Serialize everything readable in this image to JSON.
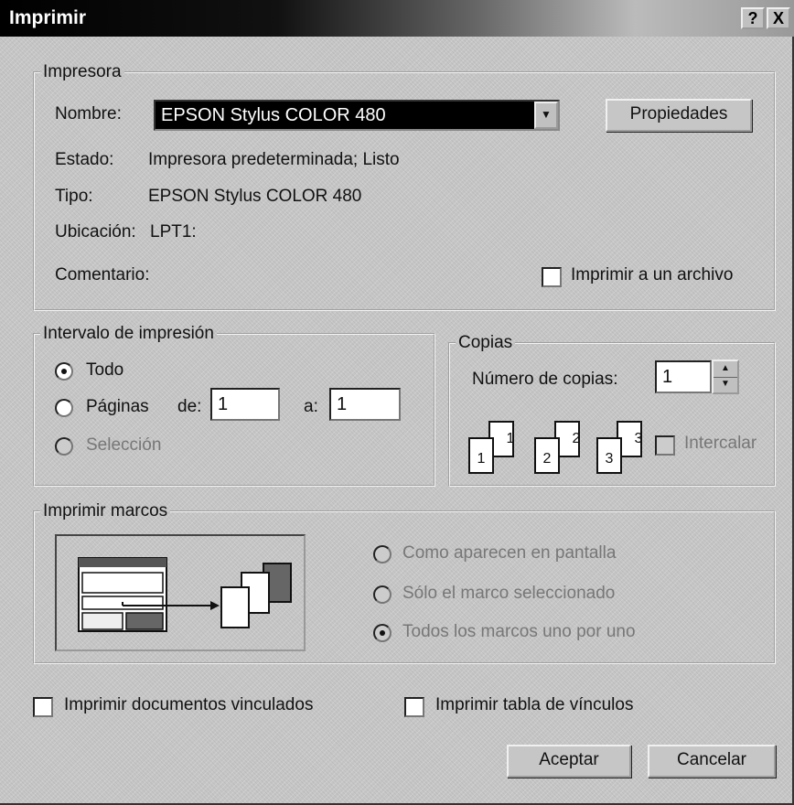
{
  "window": {
    "title": "Imprimir",
    "help_label": "?",
    "close_label": "X"
  },
  "printer": {
    "legend": "Impresora",
    "name_label": "Nombre:",
    "name_value": "EPSON Stylus COLOR 480",
    "properties_button": "Propiedades",
    "status_label": "Estado:",
    "status_value": "Impresora predeterminada; Listo",
    "type_label": "Tipo:",
    "type_value": "EPSON Stylus COLOR 480",
    "location_label": "Ubicación:",
    "location_value": "LPT1:",
    "comment_label": "Comentario:",
    "print_to_file": {
      "label": "Imprimir a un archivo",
      "checked": false
    }
  },
  "range": {
    "legend": "Intervalo de impresión",
    "all_label": "Todo",
    "pages_label": "Páginas",
    "from_label": "de:",
    "from_value": "1",
    "to_label": "a:",
    "to_value": "1",
    "selection_label": "Selección",
    "selected": "all"
  },
  "copies": {
    "legend": "Copias",
    "count_label": "Número de copias:",
    "count_value": "1",
    "collate_label": "Intercalar",
    "collate_checked": false,
    "page_numbers": [
      "1",
      "1",
      "2",
      "2",
      "3",
      "3"
    ]
  },
  "frames": {
    "legend": "Imprimir marcos",
    "options": [
      "Como aparecen en pantalla",
      "Sólo el marco seleccionado",
      "Todos los marcos uno por uno"
    ],
    "selected_index": 2
  },
  "bottom": {
    "linked_docs_label": "Imprimir documentos vinculados",
    "links_table_label": "Imprimir tabla de vínculos"
  },
  "buttons": {
    "ok": "Aceptar",
    "cancel": "Cancelar"
  }
}
